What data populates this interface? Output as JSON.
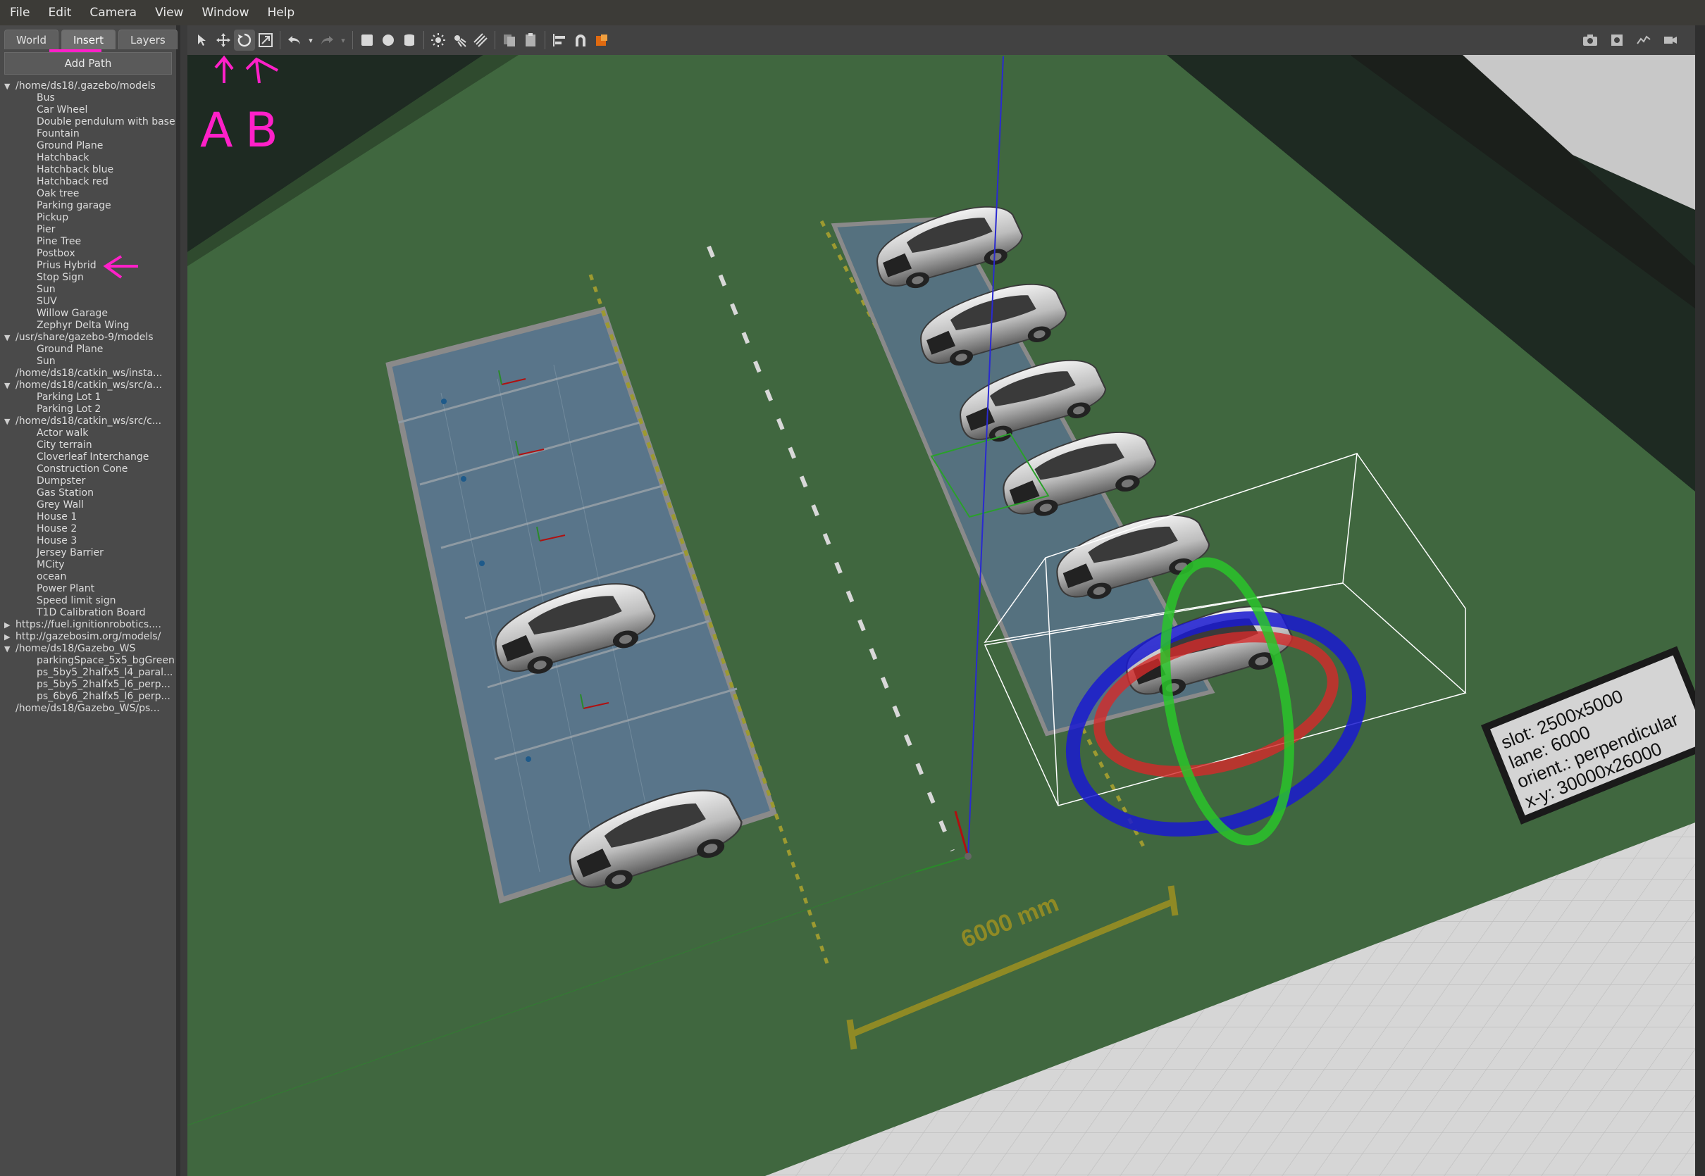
{
  "menubar": {
    "items": [
      "File",
      "Edit",
      "Camera",
      "View",
      "Window",
      "Help"
    ]
  },
  "left_panel": {
    "tabs": [
      "World",
      "Insert",
      "Layers"
    ],
    "active_tab": "Insert",
    "add_path_label": "Add Path",
    "tree": [
      {
        "path": "/home/ds18/.gazebo/models",
        "expanded": true,
        "items": [
          "Bus",
          "Car Wheel",
          "Double pendulum with base",
          "Fountain",
          "Ground Plane",
          "Hatchback",
          "Hatchback blue",
          "Hatchback red",
          "Oak tree",
          "Parking garage",
          "Pickup",
          "Pier",
          "Pine Tree",
          "Postbox",
          "Prius Hybrid",
          "Stop Sign",
          "Sun",
          "SUV",
          "Willow Garage",
          "Zephyr Delta Wing"
        ]
      },
      {
        "path": "/usr/share/gazebo-9/models",
        "expanded": true,
        "items": [
          "Ground Plane",
          "Sun"
        ]
      },
      {
        "path": "/home/ds18/catkin_ws/insta...",
        "expanded": null,
        "items": []
      },
      {
        "path": "/home/ds18/catkin_ws/src/a...",
        "expanded": true,
        "items": [
          "Parking Lot 1",
          "Parking Lot 2"
        ]
      },
      {
        "path": "/home/ds18/catkin_ws/src/c...",
        "expanded": true,
        "items": [
          "Actor walk",
          "City terrain",
          "Cloverleaf Interchange",
          "Construction Cone",
          "Dumpster",
          "Gas Station",
          "Grey Wall",
          "House 1",
          "House 2",
          "House 3",
          "Jersey Barrier",
          "MCity",
          "ocean",
          "Power Plant",
          "Speed limit sign",
          "T1D Calibration Board"
        ]
      },
      {
        "path": "https://fuel.ignitionrobotics....",
        "expanded": false,
        "items": []
      },
      {
        "path": "http://gazebosim.org/models/",
        "expanded": false,
        "items": []
      },
      {
        "path": "/home/ds18/Gazebo_WS",
        "expanded": true,
        "items": [
          "parkingSpace_5x5_bgGreen",
          "ps_5by5_2halfx5_l4_paral...",
          "ps_5by5_2halfx5_l6_perp...",
          "ps_6by6_2halfx5_l6_perp..."
        ]
      },
      {
        "path": "/home/ds18/Gazebo_WS/ps...",
        "expanded": null,
        "items": []
      }
    ]
  },
  "toolbar": {
    "left_icons": [
      "select-arrow-icon",
      "translate-icon",
      "rotate-icon",
      "scale-icon",
      "undo-icon",
      "dropdown-icon",
      "redo-icon",
      "dropdown-icon",
      "box-icon",
      "sphere-icon",
      "cylinder-icon",
      "point-light-icon",
      "spot-light-icon",
      "directional-light-icon",
      "copy-icon",
      "paste-icon",
      "align-icon",
      "snap-icon",
      "change-view-icon"
    ],
    "active_icon": "rotate-icon",
    "right_icons": [
      "screenshot-icon",
      "log-icon",
      "plot-icon",
      "video-icon"
    ]
  },
  "annotations": {
    "label_a": "A",
    "label_b": "B",
    "color": "#ff20c8"
  },
  "scene": {
    "ground_color": "#40673f",
    "measure_label": "6000 mm",
    "sign_lines": [
      "slot: 2500x5000",
      "lane: 6000",
      "orient.: perpendicular",
      "x-y: 30000x26000"
    ]
  }
}
